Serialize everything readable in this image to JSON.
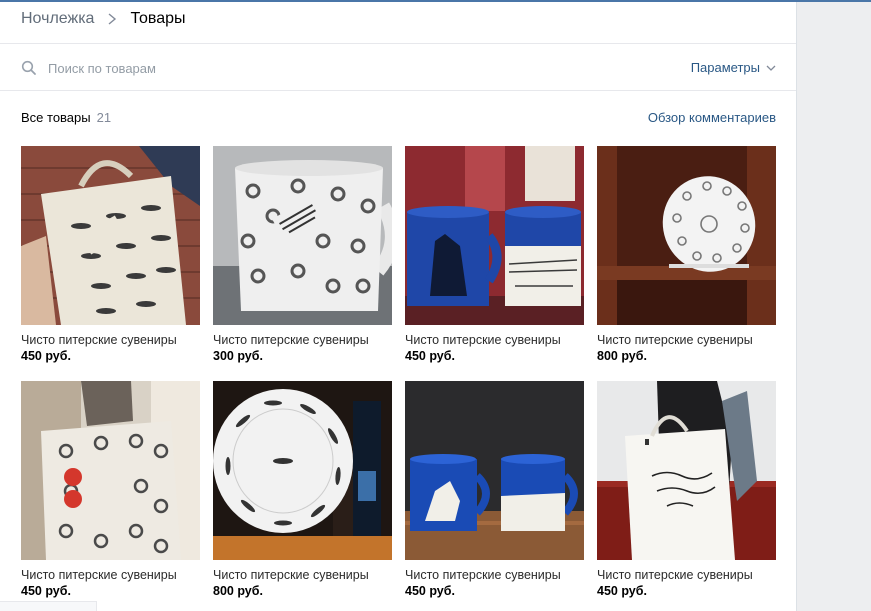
{
  "breadcrumb": {
    "parent": "Ночлежка",
    "current": "Товары"
  },
  "search": {
    "placeholder": "Поиск по товарам"
  },
  "filters": {
    "label": "Параметры"
  },
  "section": {
    "title": "Все товары",
    "count": "21",
    "overview_link": "Обзор комментариев"
  },
  "products": [
    {
      "title": "Чисто питерские сувениры",
      "price": "450 руб."
    },
    {
      "title": "Чисто питерские сувениры",
      "price": "300 руб."
    },
    {
      "title": "Чисто питерские сувениры",
      "price": "450 руб."
    },
    {
      "title": "Чисто питерские сувениры",
      "price": "800 руб."
    },
    {
      "title": "Чисто питерские сувениры",
      "price": "450 руб."
    },
    {
      "title": "Чисто питерские сувениры",
      "price": "800 руб."
    },
    {
      "title": "Чисто питерские сувениры",
      "price": "450 руб."
    },
    {
      "title": "Чисто питерские сувениры",
      "price": "450 руб."
    }
  ],
  "colors": {
    "accent": "#2a5885",
    "muted": "#828a99",
    "divider": "#e7e8ec"
  },
  "icons": {
    "search": "search-icon",
    "breadcrumb_separator": "chevron-right-icon",
    "filters": "chevron-down-icon"
  }
}
